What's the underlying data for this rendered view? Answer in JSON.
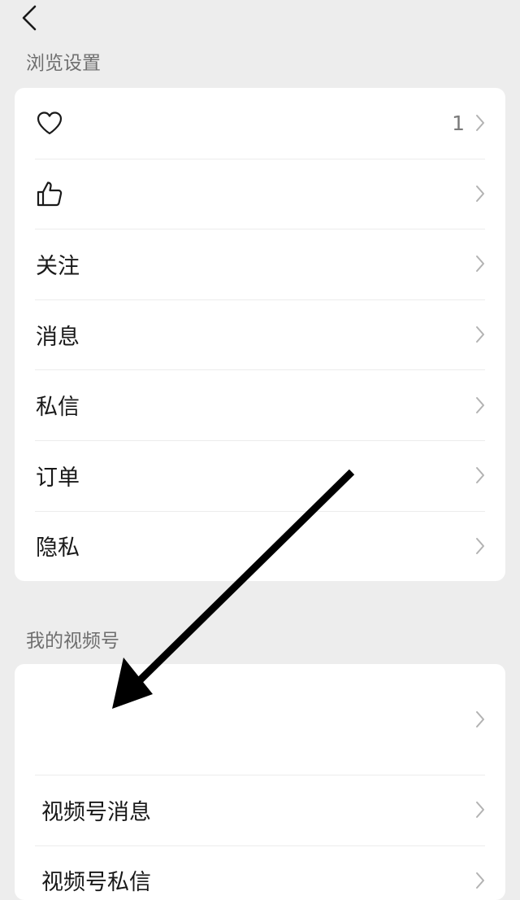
{
  "nav": {
    "back_icon": "chevron-left-icon"
  },
  "browse_section": {
    "title": "浏览设置",
    "items": [
      {
        "icon": "heart-icon",
        "value": "1"
      },
      {
        "icon": "thumbs-up-icon"
      },
      {
        "label": "关注"
      },
      {
        "label": "消息"
      },
      {
        "label": "私信"
      },
      {
        "label": "订单"
      },
      {
        "label": "隐私"
      }
    ]
  },
  "channels_section": {
    "title": "我的视频号",
    "items": [
      {
        "label": ""
      },
      {
        "label": "视频号消息"
      },
      {
        "label": "视频号私信"
      }
    ]
  },
  "colors": {
    "background": "#ededed",
    "card": "#ffffff",
    "annotation_arrow": "#000000"
  }
}
